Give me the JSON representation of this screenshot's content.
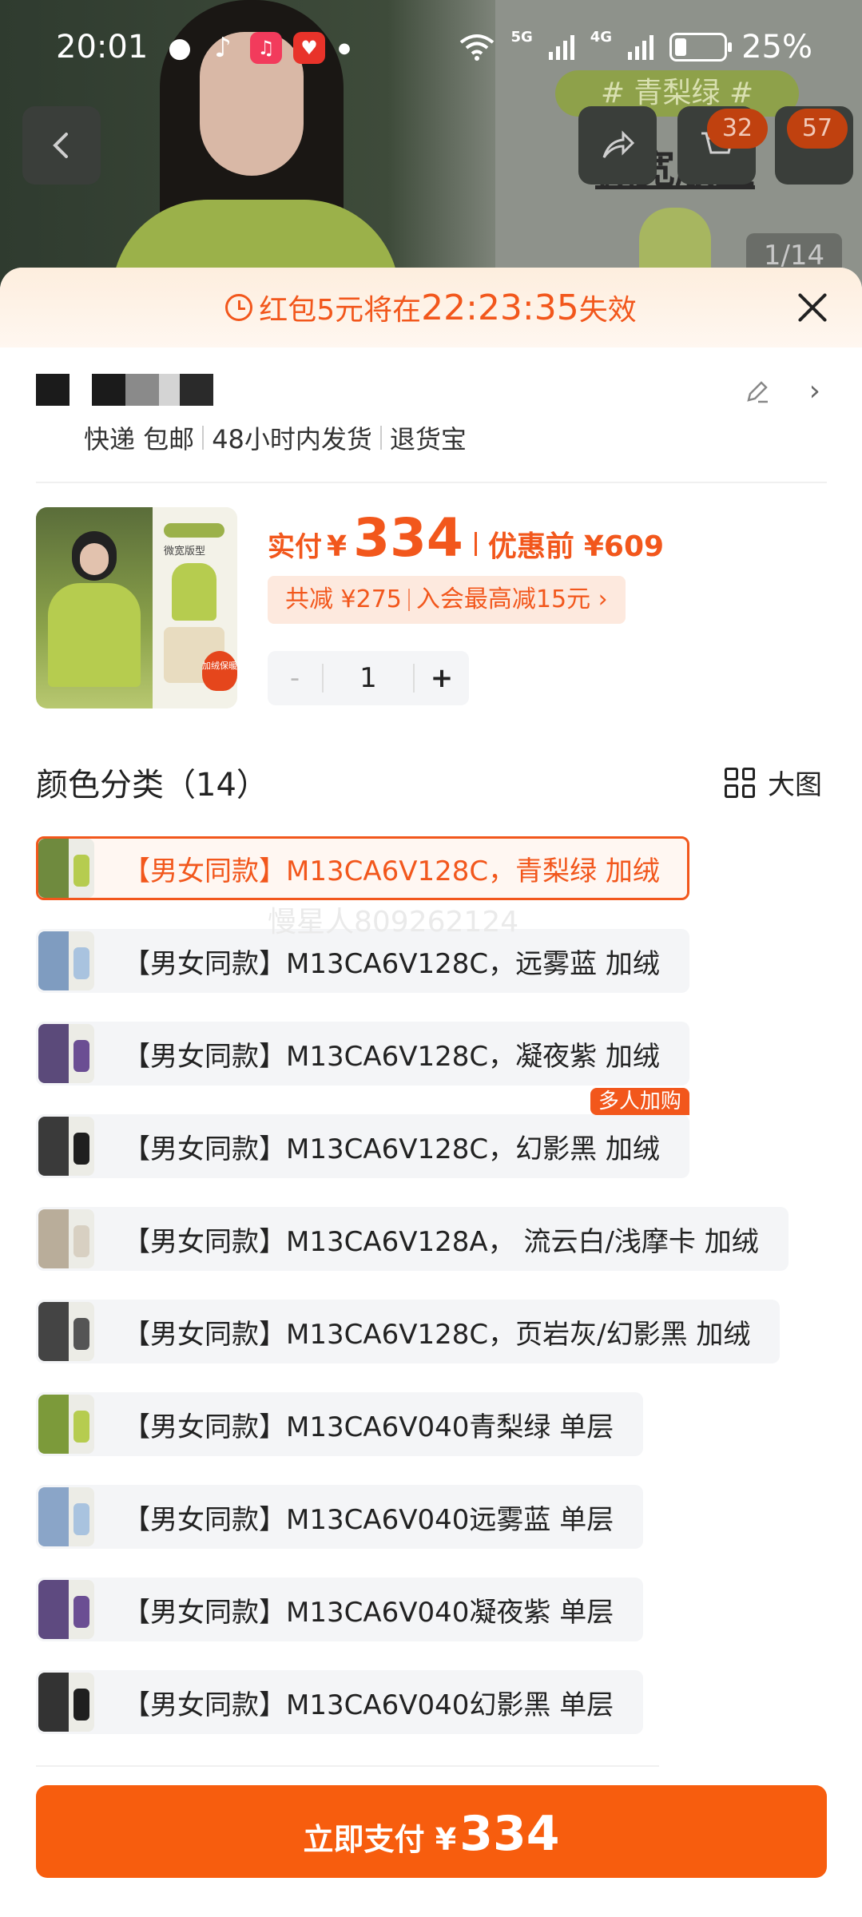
{
  "status_bar": {
    "time": "20:01",
    "network1": "5G",
    "network2": "4G",
    "battery": "25%"
  },
  "background": {
    "tag": "# 青梨绿 #",
    "title": "微宽版型",
    "cart_badge": "32",
    "more_badge": "57",
    "counter": "1/14"
  },
  "promo": {
    "text": "红包5元将在",
    "countdown": "22:23:35",
    "suffix": "失效"
  },
  "address": {
    "tags": [
      "快递 包邮",
      "48小时内发货",
      "退货宝"
    ]
  },
  "product": {
    "pay_label": "实付",
    "currency": "¥",
    "price": "334",
    "before_label": "优惠前",
    "before_price": "¥609",
    "discount_total": "共减 ¥275",
    "member_offer": "入会最高减15元 ›",
    "qty_minus": "-",
    "quantity": "1",
    "qty_plus": "+",
    "thumb_tag": "微宽版型",
    "thumb_badge": "加绒保暖"
  },
  "section": {
    "title": "颜色分类（14）",
    "big_view": "大图"
  },
  "options": [
    {
      "label": "【男女同款】M13CA6V128C，青梨绿 加绒",
      "selected": true,
      "color": "#b6cc4f",
      "img": "#6f8a3e"
    },
    {
      "label": "【男女同款】M13CA6V128C，远雾蓝 加绒",
      "selected": false,
      "color": "#a9c3df",
      "img": "#7f9cc0"
    },
    {
      "label": "【男女同款】M13CA6V128C，凝夜紫 加绒",
      "selected": false,
      "color": "#6b4e93",
      "img": "#5b4a7a"
    },
    {
      "label": "【男女同款】M13CA6V128C，幻影黑 加绒",
      "selected": false,
      "color": "#1f1f1f",
      "img": "#3a3a3a",
      "corner": "多人加购"
    },
    {
      "label": "【男女同款】M13CA6V128A， 流云白/浅摩卡 加绒",
      "selected": false,
      "color": "#d8d0c2",
      "img": "#b9ad9a"
    },
    {
      "label": "【男女同款】M13CA6V128C，页岩灰/幻影黑 加绒",
      "selected": false,
      "color": "#555555",
      "img": "#444444"
    },
    {
      "label": "【男女同款】M13CA6V040青梨绿 单层",
      "selected": false,
      "color": "#b6cc4f",
      "img": "#7c9a3a"
    },
    {
      "label": "【男女同款】M13CA6V040远雾蓝 单层",
      "selected": false,
      "color": "#a9c3df",
      "img": "#8aa5c8"
    },
    {
      "label": "【男女同款】M13CA6V040凝夜紫 单层",
      "selected": false,
      "color": "#6b4e93",
      "img": "#5e4a80"
    },
    {
      "label": "【男女同款】M13CA6V040幻影黑 单层",
      "selected": false,
      "color": "#1f1f1f",
      "img": "#333333"
    }
  ],
  "watermark": "慢星人809262124",
  "pay_button": {
    "label": "立即支付 ¥",
    "amount": "334"
  },
  "colors": {
    "accent": "#f2571c",
    "button": "#f75d0e"
  }
}
